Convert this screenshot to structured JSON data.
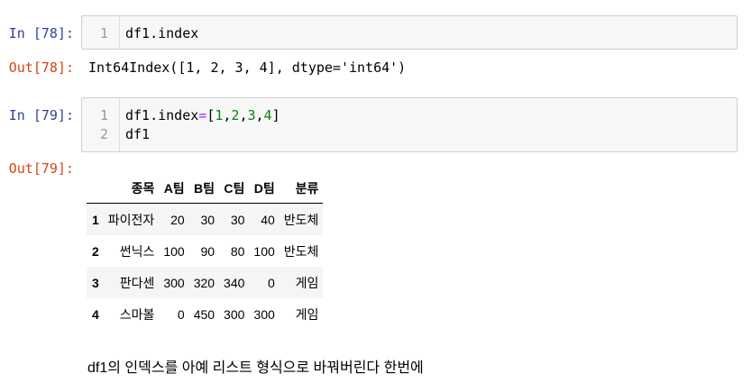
{
  "cells": [
    {
      "in_prompt": "In [78]:",
      "out_prompt": "Out[78]:",
      "line_numbers": [
        "1"
      ],
      "code": [
        "df1.index"
      ],
      "output_text": "Int64Index([1, 2, 3, 4], dtype='int64')"
    },
    {
      "in_prompt": "In [79]:",
      "out_prompt": "Out[79]:",
      "line_numbers": [
        "1",
        "2"
      ],
      "code_line1": {
        "var": "df1.index",
        "eq": "=",
        "lb": "[",
        "n1": "1",
        "c1": ",",
        "n2": "2",
        "c2": ",",
        "n3": "3",
        "c3": ",",
        "n4": "4",
        "rb": "]"
      },
      "code_line2": "df1",
      "table": {
        "columns": [
          "",
          "종목",
          "A팀",
          "B팀",
          "C팀",
          "D팀",
          "분류"
        ],
        "rows": [
          [
            "1",
            "파이전자",
            "20",
            "30",
            "30",
            "40",
            "반도체"
          ],
          [
            "2",
            "썬닉스",
            "100",
            "90",
            "80",
            "100",
            "반도체"
          ],
          [
            "3",
            "판다센",
            "300",
            "320",
            "340",
            "0",
            "게임"
          ],
          [
            "4",
            "스마볼",
            "0",
            "450",
            "300",
            "300",
            "게임"
          ]
        ]
      }
    }
  ],
  "markdown_text": "df1의 인덱스를 아예 리스트 형식으로 바꿔버린다 한번에",
  "colors": {
    "in_prompt": "#303f9f",
    "out_prompt": "#d84315",
    "operator": "#aa22ff",
    "number": "#008800"
  }
}
